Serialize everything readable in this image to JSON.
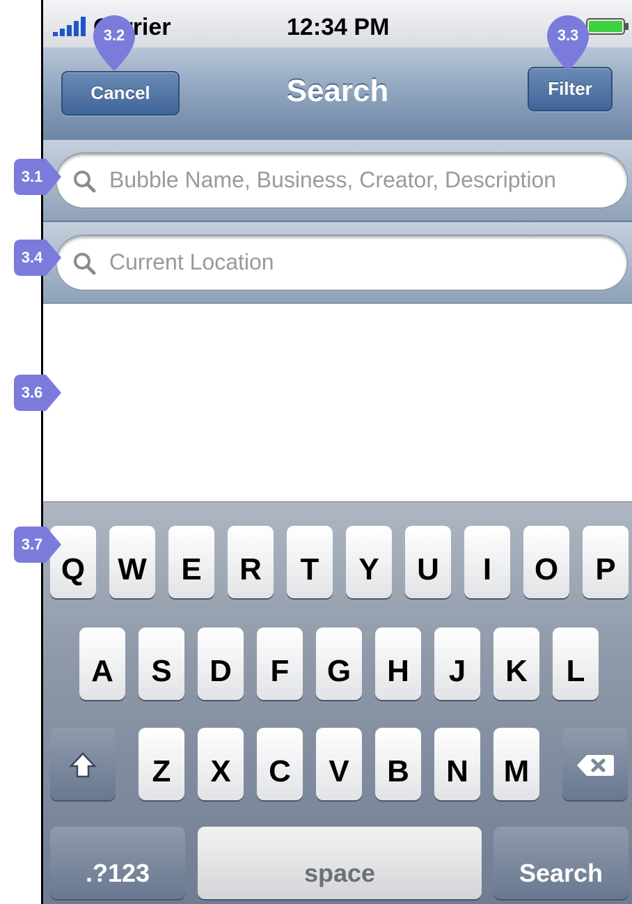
{
  "status_bar": {
    "carrier": "Carrier",
    "time": "12:34 PM",
    "signal_icon": "signal-bars-icon",
    "battery_icon": "battery-icon"
  },
  "nav_bar": {
    "title": "Search",
    "cancel_label": "Cancel",
    "filter_label": "Filter"
  },
  "search": {
    "query_placeholder": "Bubble Name, Business, Creator, Description",
    "location_placeholder": "Current Location",
    "search_icon": "magnifier-icon"
  },
  "annotations": {
    "search_field": "3.1",
    "cancel": "3.2",
    "filter": "3.3",
    "location_field": "3.4",
    "results": "3.6",
    "keyboard": "3.7",
    "marker_color": "#7b7bdc"
  },
  "keyboard": {
    "row1": [
      "Q",
      "W",
      "E",
      "R",
      "T",
      "Y",
      "U",
      "I",
      "O",
      "P"
    ],
    "row2": [
      "A",
      "S",
      "D",
      "F",
      "G",
      "H",
      "J",
      "K",
      "L"
    ],
    "row3": [
      "Z",
      "X",
      "C",
      "V",
      "B",
      "N",
      "M"
    ],
    "shift_icon": "shift-arrow-icon",
    "delete_icon": "backspace-icon",
    "numbers_label": ".?123",
    "space_label": "space",
    "search_label": "Search"
  },
  "colors": {
    "nav_button": "#4a6fa0",
    "nav_bar": "#8ea3bd",
    "battery_fill": "#3fcf3f"
  }
}
